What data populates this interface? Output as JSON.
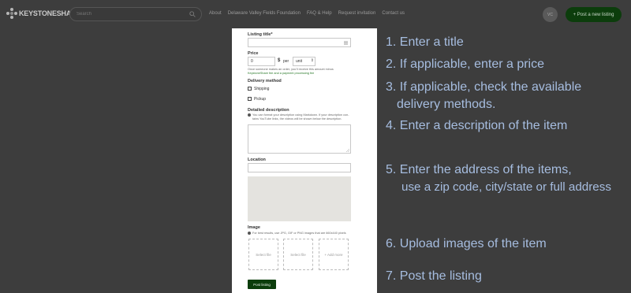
{
  "header": {
    "logo_text": "KEYSTONESHARE",
    "search_placeholder": "Search",
    "nav": [
      "About",
      "Delaware Valley Fields Foundation",
      "FAQ & Help",
      "Request invitation",
      "Contact us"
    ],
    "avatar_initials": "VC",
    "post_button": "+ Post a new listing"
  },
  "form": {
    "title_label": "Listing title*",
    "price_label": "Price",
    "price_value": "0",
    "currency": "$",
    "per_label": "per",
    "unit_value": "unit",
    "price_note_1": "Once someone makes an order, you'll receive this amount minus",
    "price_note_2": "KeystoneShare fee and a payment processing fee",
    "delivery_label": "Delivery method",
    "delivery_options": [
      "Shipping",
      "Pickup"
    ],
    "description_label": "Detailed description",
    "description_note_1": "You can format your description using Markdown. If your description con-",
    "description_note_2": "tains YouTube links, the videos will be shown below the description.",
    "location_label": "Location",
    "image_label": "Image",
    "image_note": "For best results, use JPG, GIF or PNG images that are 660x440 pixels",
    "upload_slots": [
      "Select file",
      "Select file",
      "+ Add more"
    ],
    "submit_label": "Post listing"
  },
  "instructions": {
    "s1": "1. Enter a title",
    "s2": "2. If applicable, enter a price",
    "s3a": "3. If applicable, check the available",
    "s3b": "delivery methods.",
    "s4": "4. Enter a description of the item",
    "s5a": "5. Enter the address of the items,",
    "s5b": "use a zip code, city/state or full address",
    "s6": "6. Upload images of the item",
    "s7": "7. Post the listing"
  },
  "colors": {
    "background": "#3d3d3d",
    "brand_green": "#0c3d0c",
    "instruction_text": "#a6bde0"
  }
}
